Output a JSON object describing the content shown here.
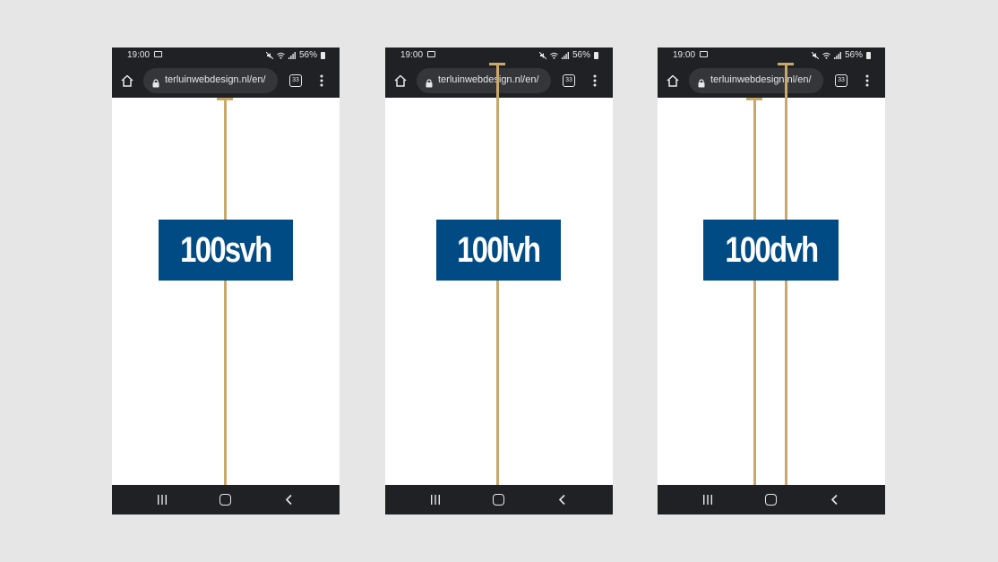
{
  "status_bar": {
    "time": "19:00",
    "battery": "56%"
  },
  "browser": {
    "url": "terluinwebdesign.nl/en/",
    "tab_count": "33"
  },
  "icons": {
    "home": "home-icon",
    "lock": "lock-icon",
    "menu": "more-vert-icon",
    "tabs": "tab-switcher-icon",
    "nav_recents": "recents-icon",
    "nav_home": "nav-home-icon",
    "nav_back": "back-icon"
  },
  "colors": {
    "background": "#e6e6e6",
    "chrome": "#202124",
    "url_pill": "#35363a",
    "label_box": "#004b84",
    "measure_line": "#c9a86a"
  },
  "phones": [
    {
      "label": "100svh"
    },
    {
      "label": "100lvh"
    },
    {
      "label": "100dvh"
    }
  ]
}
